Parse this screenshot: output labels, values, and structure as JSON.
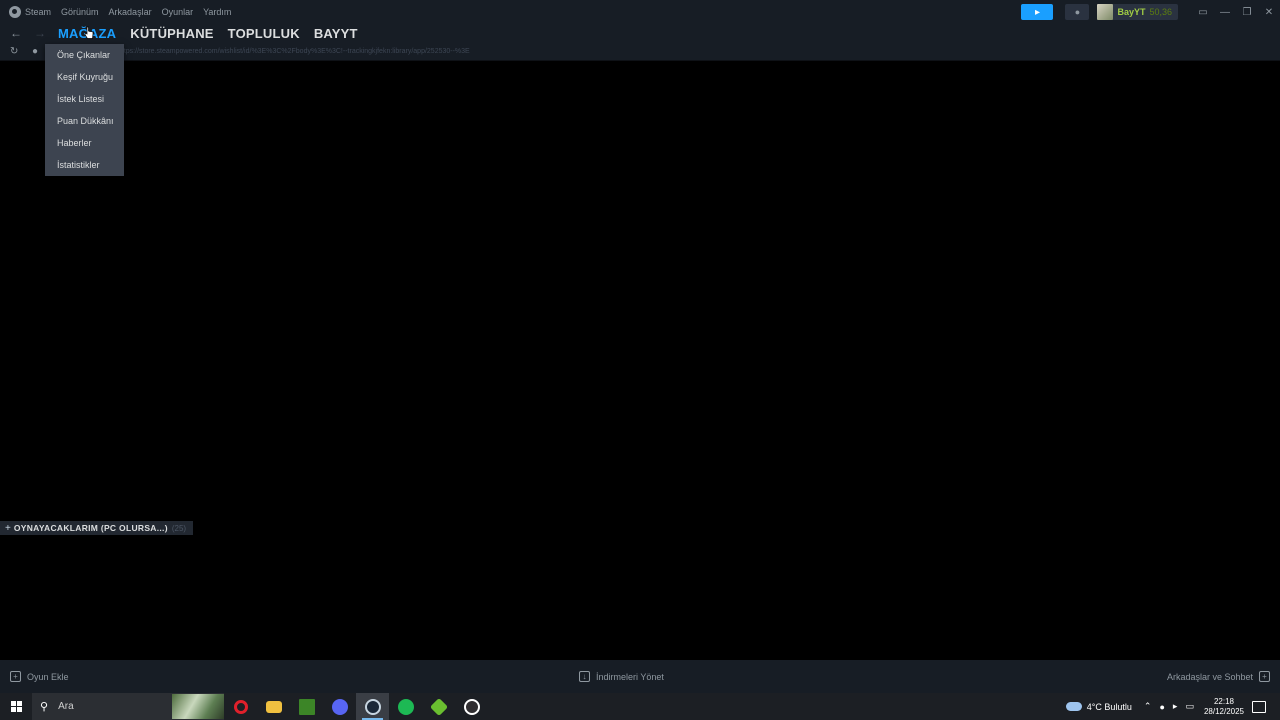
{
  "menubar": {
    "items": [
      "Steam",
      "Görünüm",
      "Arkadaşlar",
      "Oyunlar",
      "Yardım"
    ],
    "username": "BayYT",
    "balance": "50,36",
    "accent_color": "#1a9fff",
    "username_color": "#a1cd44"
  },
  "nav": {
    "tabs": [
      "MAĞAZA",
      "KÜTÜPHANE",
      "TOPLULUK",
      "BAYYT"
    ],
    "active_tab": "MAĞAZA"
  },
  "urlbar": {
    "url": "https://store.steampowered.com/wishlist/id/%3E%3C%2Fbody%3E%3C!--trackingkjfekn:library/app/252530--%3E"
  },
  "store_dropdown": {
    "items": [
      "Öne Çıkanlar",
      "Keşif Kuyruğu",
      "İstek Listesi",
      "Puan Dükkânı",
      "Haberler",
      "İstatistikler"
    ]
  },
  "collection": {
    "name": "OYNAYACAKLARIM (PC OLURSA...)",
    "count": "(25)"
  },
  "statusbar": {
    "add_game": "Oyun Ekle",
    "manage_downloads": "İndirmeleri Yönet",
    "friends_chat": "Arkadaşlar ve Sohbet"
  },
  "taskbar": {
    "search_placeholder": "Ara",
    "apps": [
      "opera-icon",
      "file-explorer-icon",
      "minecraft-icon",
      "discord-icon",
      "steam-icon",
      "spotify-icon",
      "game-icon",
      "obs-icon"
    ],
    "weather": "4°C  Bulutlu",
    "time": "22:18",
    "date": "28/12/2025"
  }
}
